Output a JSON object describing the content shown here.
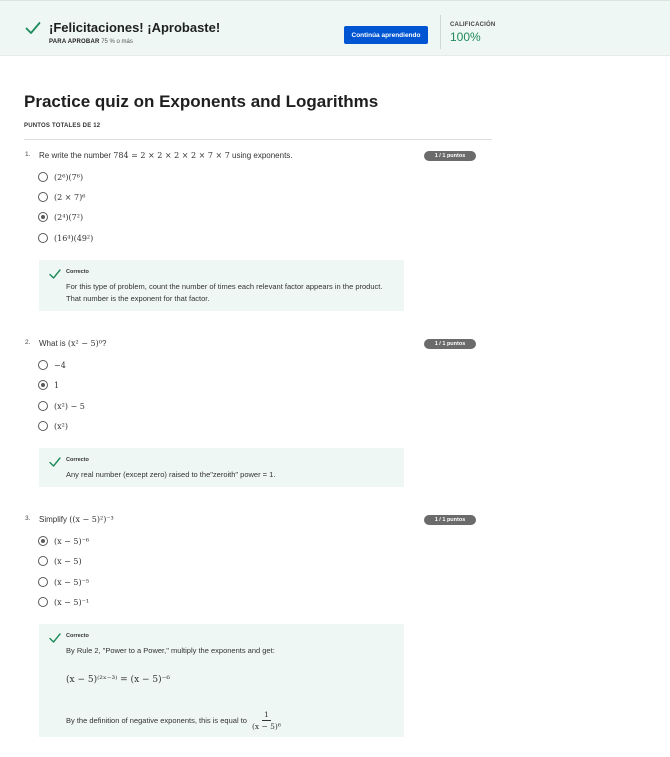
{
  "banner": {
    "title": "¡Felicitaciones! ¡Aprobaste!",
    "pass_label": "PARA APROBAR",
    "pass_value": "75 % o más",
    "continue_button": "Continúa aprendiendo",
    "grade_label": "CALIFICACIÓN",
    "grade_value": "100%",
    "accent_color": "#0056d2",
    "success_color": "#1f8a5c"
  },
  "quiz": {
    "title": "Practice quiz on Exponents and Logarithms",
    "total_points": "PUNTOS TOTALES DE 12"
  },
  "questions": [
    {
      "number": "1.",
      "text_prefix": "Re write the number ",
      "text_math": "784 = 2 × 2 × 2 × 2 × 7 × 7",
      "text_suffix": " using exponents.",
      "points": "1 / 1 puntos",
      "options": [
        {
          "label": "(2⁶)(7⁶)",
          "selected": false
        },
        {
          "label": "(2 × 7)⁶",
          "selected": false
        },
        {
          "label": "(2⁴)(7²)",
          "selected": true
        },
        {
          "label": "(16⁴)(49²)",
          "selected": false
        }
      ],
      "feedback": {
        "status": "Correcto",
        "line1": "For this type of problem, count the number of times each relevant factor appears in the product.",
        "line2": "That number is the exponent for that factor."
      }
    },
    {
      "number": "2.",
      "text_prefix": "What is ",
      "text_math": "(x² − 5)⁰",
      "text_suffix": "?",
      "points": "1 / 1 puntos",
      "options": [
        {
          "label": "−4",
          "selected": false
        },
        {
          "label": "1",
          "selected": true
        },
        {
          "label": "(x²) − 5",
          "selected": false
        },
        {
          "label": "(x²)",
          "selected": false
        }
      ],
      "feedback": {
        "status": "Correcto",
        "line1": "Any real number (except zero) raised to the\"zeroith\" power = 1."
      }
    },
    {
      "number": "3.",
      "text_prefix": "Simplify ",
      "text_math": "((x − 5)²)⁻³",
      "text_suffix": "",
      "points": "1 / 1 puntos",
      "options": [
        {
          "label": "(x − 5)⁻⁶",
          "selected": true
        },
        {
          "label": "(x − 5)",
          "selected": false
        },
        {
          "label": "(x − 5)⁻⁵",
          "selected": false
        },
        {
          "label": "(x − 5)⁻¹",
          "selected": false
        }
      ],
      "feedback": {
        "status": "Correcto",
        "line1": "By Rule 2, \"Power to a Power,\" multiply the exponents and get:",
        "math": "(x − 5)⁽²ˣ⁻³⁾ = (x − 5)⁻⁶",
        "line2": "By the definition of negative exponents, this is equal to",
        "frac_num": "1",
        "frac_den": "(x − 5)⁶"
      }
    }
  ]
}
